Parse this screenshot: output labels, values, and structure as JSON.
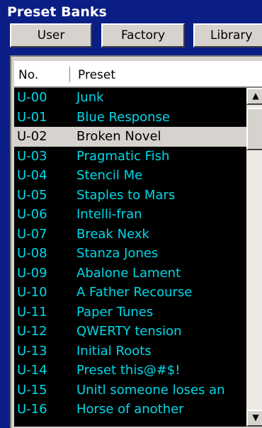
{
  "window": {
    "title": "Preset Banks"
  },
  "tabs": [
    {
      "label": "User"
    },
    {
      "label": "Factory"
    },
    {
      "label": "Library"
    }
  ],
  "table": {
    "headers": {
      "no": "No.",
      "preset": "Preset"
    },
    "selected_index": 2,
    "rows": [
      {
        "no": "U-00",
        "name": "Junk"
      },
      {
        "no": "U-01",
        "name": "Blue Response"
      },
      {
        "no": "U-02",
        "name": "Broken Novel"
      },
      {
        "no": "U-03",
        "name": "Pragmatic Fish"
      },
      {
        "no": "U-04",
        "name": "Stencil Me"
      },
      {
        "no": "U-05",
        "name": "Staples to Mars"
      },
      {
        "no": "U-06",
        "name": "Intelli-fran"
      },
      {
        "no": "U-07",
        "name": "Break Nexk"
      },
      {
        "no": "U-08",
        "name": "Stanza Jones"
      },
      {
        "no": "U-09",
        "name": "Abalone Lament"
      },
      {
        "no": "U-10",
        "name": "A Father Recourse"
      },
      {
        "no": "U-11",
        "name": "Paper Tunes"
      },
      {
        "no": "U-12",
        "name": "QWERTY tension"
      },
      {
        "no": "U-13",
        "name": "Initial Roots"
      },
      {
        "no": "U-14",
        "name": "Preset this@#$!"
      },
      {
        "no": "U-15",
        "name": "Unitl someone loses an"
      },
      {
        "no": "U-16",
        "name": "Horse of another"
      }
    ]
  },
  "scrollbar": {
    "up_icon": "scroll-up-arrow-icon",
    "down_icon": "scroll-down-arrow-icon"
  },
  "colors": {
    "window_bg": "#0a1e85",
    "list_bg": "#000000",
    "row_text": "#00d8e8",
    "selected_bg": "#d6d3ce",
    "selected_text": "#000000"
  }
}
